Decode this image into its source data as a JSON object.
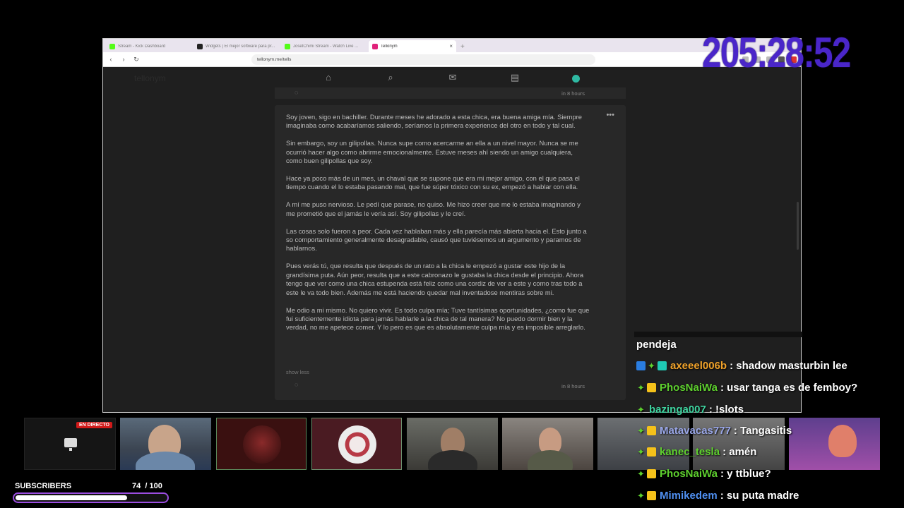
{
  "browser": {
    "tabs": [
      {
        "title": "Stream - Kick Dashboard",
        "favicon_color": "#53fc18"
      },
      {
        "title": "Widgets | El mejor software para pr...",
        "favicon_color": "#222222"
      },
      {
        "title": "JosetChimi Stream - Watch Live ...",
        "favicon_color": "#53fc18"
      },
      {
        "title": "Tellonym",
        "favicon_color": "#e0227a"
      }
    ],
    "new_tab_label": "+",
    "close_tab_label": "×",
    "url": "tellonym.me/tells"
  },
  "app": {
    "brand": "tellonym",
    "nav_icons": [
      "home-icon",
      "search-icon",
      "inbox-icon",
      "chat-icon"
    ],
    "accent_color": "#2fb9a3"
  },
  "previous_tell": {
    "time": "in 8 hours"
  },
  "tell": {
    "paragraphs": [
      "Soy joven, sigo en bachiller. Durante meses he adorado a esta chica, era buena amiga mía. Siempre imaginaba como acabaríamos saliendo, seríamos la primera experience del otro en todo y tal cual.",
      "Sin embargo, soy un gilipollas. Nunca supe como acercarme an ella a un nivel mayor. Nunca se me ocurrió hacer algo como abrirme emocionalmente. Estuve meses ahí siendo un amigo cualquiera, como buen gilipollas que soy.",
      "Hace ya poco más de un mes, un chaval que se supone que era mi mejor amigo, con el que pasa el tiempo cuando el lo estaba pasando mal, que fue súper tóxico con su ex, empezó a hablar con ella.",
      "A mí me puso nervioso. Le pedí que parase, no quiso. Me hizo creer que me lo estaba imaginando y me prometió que el jamás le vería así. Soy gilipollas y le creí.",
      "Las cosas solo fueron a peor. Cada vez hablaban más y ella parecía más abierta hacia el. Esto junto a so comportamiento generalmente desagradable, causó que tuviésemos un argumento y paramos de hablarnos.",
      "Pues verás tú, que resulta que después de un rato a la chica le empezó a gustar este hijo de la grandísima puta. Aún peor, resulta que a este cabronazo le gustaba la chica desde el principio. Ahora tengo que ver como una chica estupenda está feliz como una cordiz de ver a este y como tras todo a este le va todo bien. Además me está haciendo quedar mal inventadose mentiras sobre mi.",
      "Me odio a mi mismo. No quiero vivir. Es todo culpa mía; Tuve tantísimas oportunidades, ¿como fue que fui suficientemente idiota para jamás hablarle a la chica de tal manera? No puedo dormir bien y la verdad, no me apetece comer. Y lo pero es que es absolutamente culpa mía y es imposible arreglarlo."
    ],
    "show_less": "show less",
    "time": "in 8 hours"
  },
  "timer": "205:28:52",
  "live_badge": "EN DIRECTO",
  "subscribers": {
    "label": "SUBSCRIBERS",
    "count_text": "74  / 100",
    "current": 74,
    "goal": 100,
    "progress": 0.74
  },
  "chat": [
    {
      "user": "",
      "message": "pendeja",
      "user_color": "#ffffff",
      "badges": []
    },
    {
      "user": "axeeel006b",
      "message": ": shadow masturbin lee",
      "user_color": "#f0a22a",
      "badges": [
        "blue",
        "diamond",
        "teal"
      ]
    },
    {
      "user": "PhosNaiWa",
      "message": ": usar tanga es de femboy?",
      "user_color": "#5ed02e",
      "badges": [
        "diamond",
        "crown"
      ]
    },
    {
      "user": "bazinga007",
      "message": ": !slots",
      "user_color": "#3fd4a0",
      "badges": [
        "diamond"
      ]
    },
    {
      "user": "Matavacas777",
      "message": ": Tangasitis",
      "user_color": "#9aa7e8",
      "badges": [
        "diamond",
        "crown"
      ]
    },
    {
      "user": "kanec_tesla",
      "message": ": amén",
      "user_color": "#5ed02e",
      "badges": [
        "diamond",
        "crown"
      ]
    },
    {
      "user": "PhosNaiWa",
      "message": ": y ttblue?",
      "user_color": "#5ed02e",
      "badges": [
        "diamond",
        "crown"
      ]
    },
    {
      "user": "Mimikedem",
      "message": ": su puta madre",
      "user_color": "#4f8ff0",
      "badges": [
        "diamond",
        "crown"
      ]
    }
  ]
}
